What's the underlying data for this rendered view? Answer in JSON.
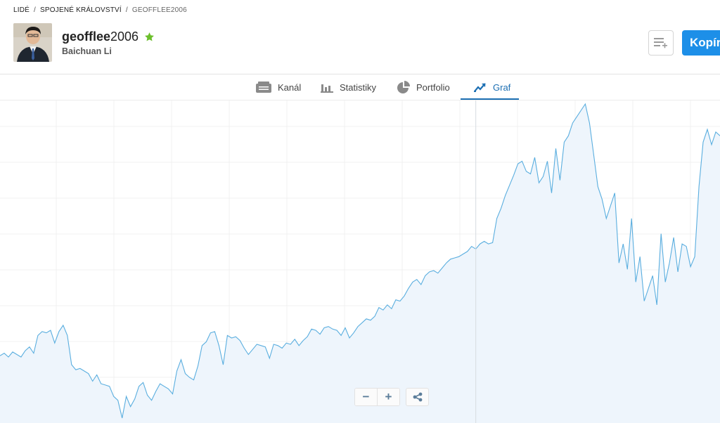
{
  "breadcrumb": {
    "items": [
      "LIDÉ",
      "SPOJENÉ KRÁLOVSTVÍ",
      "GEOFFLEE2006"
    ],
    "separator": "/"
  },
  "profile": {
    "username_bold": "geofflee",
    "username_rest": "2006",
    "real_name": "Baichuan Li",
    "badge_icon": "star-icon",
    "badge_color": "#6cbf2c"
  },
  "actions": {
    "list_icon": "list-add-icon",
    "copy_label": "Kopír"
  },
  "tabs": [
    {
      "label": "Kanál",
      "icon": "feed-icon",
      "active": false
    },
    {
      "label": "Statistiky",
      "icon": "bar-chart-icon",
      "active": false
    },
    {
      "label": "Portfolio",
      "icon": "pie-chart-icon",
      "active": false
    },
    {
      "label": "Graf",
      "icon": "trend-icon",
      "active": true
    }
  ],
  "colors": {
    "accent": "#1c6fb3",
    "button": "#1d8fe8",
    "line": "#5aaedf",
    "fill": "#eef5fc"
  },
  "zoom": {
    "minus": "−",
    "plus": "+",
    "share_icon": "share-icon"
  },
  "chart_data": {
    "type": "area",
    "y": [
      52,
      54,
      51,
      55,
      53,
      51,
      56,
      59,
      54,
      68,
      71,
      70,
      72,
      62,
      71,
      76,
      68,
      45,
      41,
      42,
      40,
      38,
      32,
      37,
      30,
      29,
      28,
      20,
      17,
      3,
      20,
      12,
      18,
      28,
      31,
      21,
      17,
      24,
      30,
      28,
      26,
      22,
      40,
      49,
      38,
      35,
      33,
      44,
      60,
      63,
      70,
      71,
      60,
      45,
      68,
      66,
      67,
      64,
      58,
      53,
      57,
      61,
      60,
      59,
      50,
      61,
      60,
      58,
      62,
      61,
      65,
      60,
      64,
      67,
      73,
      72,
      69,
      74,
      75,
      73,
      72,
      68,
      74,
      66,
      70,
      75,
      78,
      81,
      80,
      83,
      90,
      88,
      92,
      89,
      96,
      95,
      99,
      105,
      110,
      112,
      108,
      115,
      118,
      119,
      117,
      121,
      125,
      128,
      129,
      130,
      132,
      134,
      138,
      136,
      140,
      142,
      140,
      141,
      160,
      168,
      178,
      186,
      194,
      203,
      205,
      197,
      195,
      208,
      188,
      193,
      205,
      180,
      215,
      190,
      220,
      225,
      235,
      240,
      245,
      250,
      235,
      210,
      185,
      175,
      160,
      170,
      180,
      125,
      140,
      120,
      160,
      110,
      130,
      95,
      105,
      115,
      92,
      148,
      110,
      125,
      145,
      118,
      140,
      138,
      122,
      130,
      185,
      220,
      230,
      218,
      228,
      225
    ],
    "crosshair_index": 113,
    "grid": true,
    "title": "",
    "xlabel": "",
    "ylabel": ""
  }
}
